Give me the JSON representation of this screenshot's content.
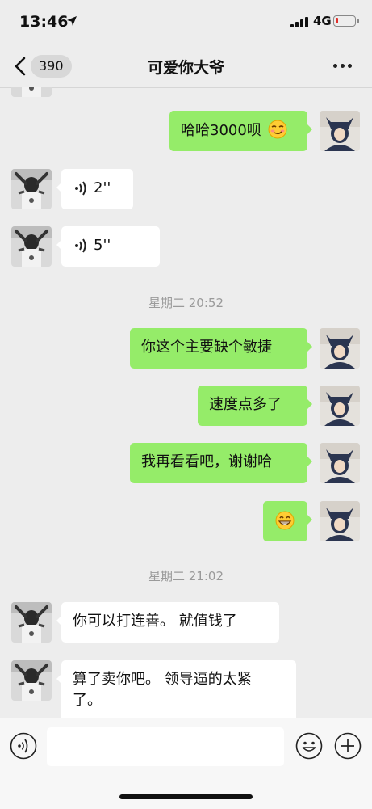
{
  "status_bar": {
    "time": "13:46",
    "network": "4G"
  },
  "nav": {
    "unread_count": "390",
    "title": "可爱你大爷"
  },
  "messages": [
    {
      "text": "哈哈3000呗"
    },
    {
      "duration": "2''"
    },
    {
      "duration": "5''"
    },
    {
      "time": "星期二 20:52"
    },
    {
      "text": "你这个主要缺个敏捷"
    },
    {
      "text": "速度点多了"
    },
    {
      "text": "我再看看吧，谢谢哈"
    },
    {
      "text": ""
    },
    {
      "time": "星期二 21:02"
    },
    {
      "text": "你可以打连善。 就值钱了"
    },
    {
      "text": "算了卖你吧。 领导逼的太紧了。"
    }
  ],
  "input": {
    "placeholder": ""
  },
  "icons": {
    "back": "chevron-left-icon",
    "more": "more-icon",
    "voice": "voice-icon",
    "emoji": "emoji-icon",
    "plus": "plus-icon"
  },
  "colors": {
    "my_bubble": "#95ec69",
    "friend_bubble": "#ffffff",
    "background": "#ededed"
  }
}
